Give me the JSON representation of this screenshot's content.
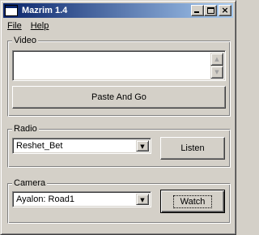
{
  "window": {
    "title": "Mazrim 1.4",
    "minimize_glyph": "",
    "maximize_glyph": "",
    "close_glyph": "×",
    "icons": [
      "app-window-icon",
      "minimize-icon",
      "maximize-icon",
      "close-icon"
    ]
  },
  "menu": {
    "file_label": "File",
    "help_label": "Help"
  },
  "video": {
    "group_label": "Video",
    "url_value": "",
    "scroll_up_glyph": "▲",
    "scroll_down_glyph": "▼",
    "paste_button": "Paste And Go"
  },
  "radio": {
    "group_label": "Radio",
    "selected_station": "Reshet_Bet",
    "dropdown_glyph": "▼",
    "listen_button": "Listen"
  },
  "camera": {
    "group_label": "Camera",
    "selected_camera": "Ayalon: Road1",
    "dropdown_glyph": "▼",
    "watch_button": "Watch"
  },
  "colors": {
    "face": "#d4d0c8",
    "title_active_start": "#0a246a",
    "title_active_end": "#a6caf0"
  }
}
